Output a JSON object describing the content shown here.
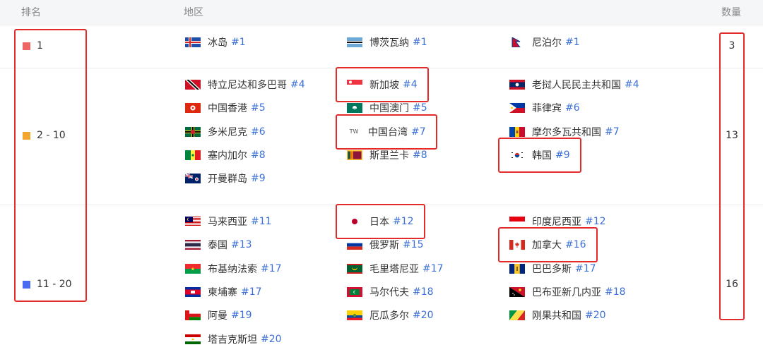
{
  "header": {
    "rank": "排名",
    "region": "地区",
    "count": "数量"
  },
  "groups": [
    {
      "rank": "1",
      "count": "3",
      "color": "#ee6666",
      "items": [
        {
          "name": "冰岛",
          "rank": "#1"
        },
        {
          "name": "博茨瓦纳",
          "rank": "#1"
        },
        {
          "name": "尼泊尔",
          "rank": "#1"
        }
      ]
    },
    {
      "rank": "2 - 10",
      "count": "13",
      "color": "#f4a52f",
      "items": [
        {
          "name": "特立尼达和多巴哥",
          "rank": "#4"
        },
        {
          "name": "新加坡",
          "rank": "#4"
        },
        {
          "name": "老挝人民民主共和国",
          "rank": "#4"
        },
        {
          "name": "中国香港",
          "rank": "#5"
        },
        {
          "name": "中国澳门",
          "rank": "#5"
        },
        {
          "name": "菲律宾",
          "rank": "#6"
        },
        {
          "name": "多米尼克",
          "rank": "#6"
        },
        {
          "name": "中国台湾",
          "rank": "#7",
          "badge": "TW"
        },
        {
          "name": "摩尔多瓦共和国",
          "rank": "#7"
        },
        {
          "name": "塞内加尔",
          "rank": "#8"
        },
        {
          "name": "斯里兰卡",
          "rank": "#8"
        },
        {
          "name": "韩国",
          "rank": "#9"
        },
        {
          "name": "开曼群岛",
          "rank": "#9"
        }
      ]
    },
    {
      "rank": "11 - 20",
      "count": "16",
      "color": "#4a6cf0",
      "items": [
        {
          "name": "马来西亚",
          "rank": "#11"
        },
        {
          "name": "日本",
          "rank": "#12"
        },
        {
          "name": "印度尼西亚",
          "rank": "#12"
        },
        {
          "name": "泰国",
          "rank": "#13"
        },
        {
          "name": "俄罗斯",
          "rank": "#15"
        },
        {
          "name": "加拿大",
          "rank": "#16"
        },
        {
          "name": "布基纳法索",
          "rank": "#17"
        },
        {
          "name": "毛里塔尼亚",
          "rank": "#17"
        },
        {
          "name": "巴巴多斯",
          "rank": "#17"
        },
        {
          "name": "柬埔寨",
          "rank": "#17"
        },
        {
          "name": "马尔代夫",
          "rank": "#18"
        },
        {
          "name": "巴布亚新几内亚",
          "rank": "#18"
        },
        {
          "name": "阿曼",
          "rank": "#19"
        },
        {
          "name": "厄瓜多尔",
          "rank": "#20"
        },
        {
          "name": "刚果共和国",
          "rank": "#20"
        },
        {
          "name": "塔吉克斯坦",
          "rank": "#20"
        }
      ]
    }
  ]
}
